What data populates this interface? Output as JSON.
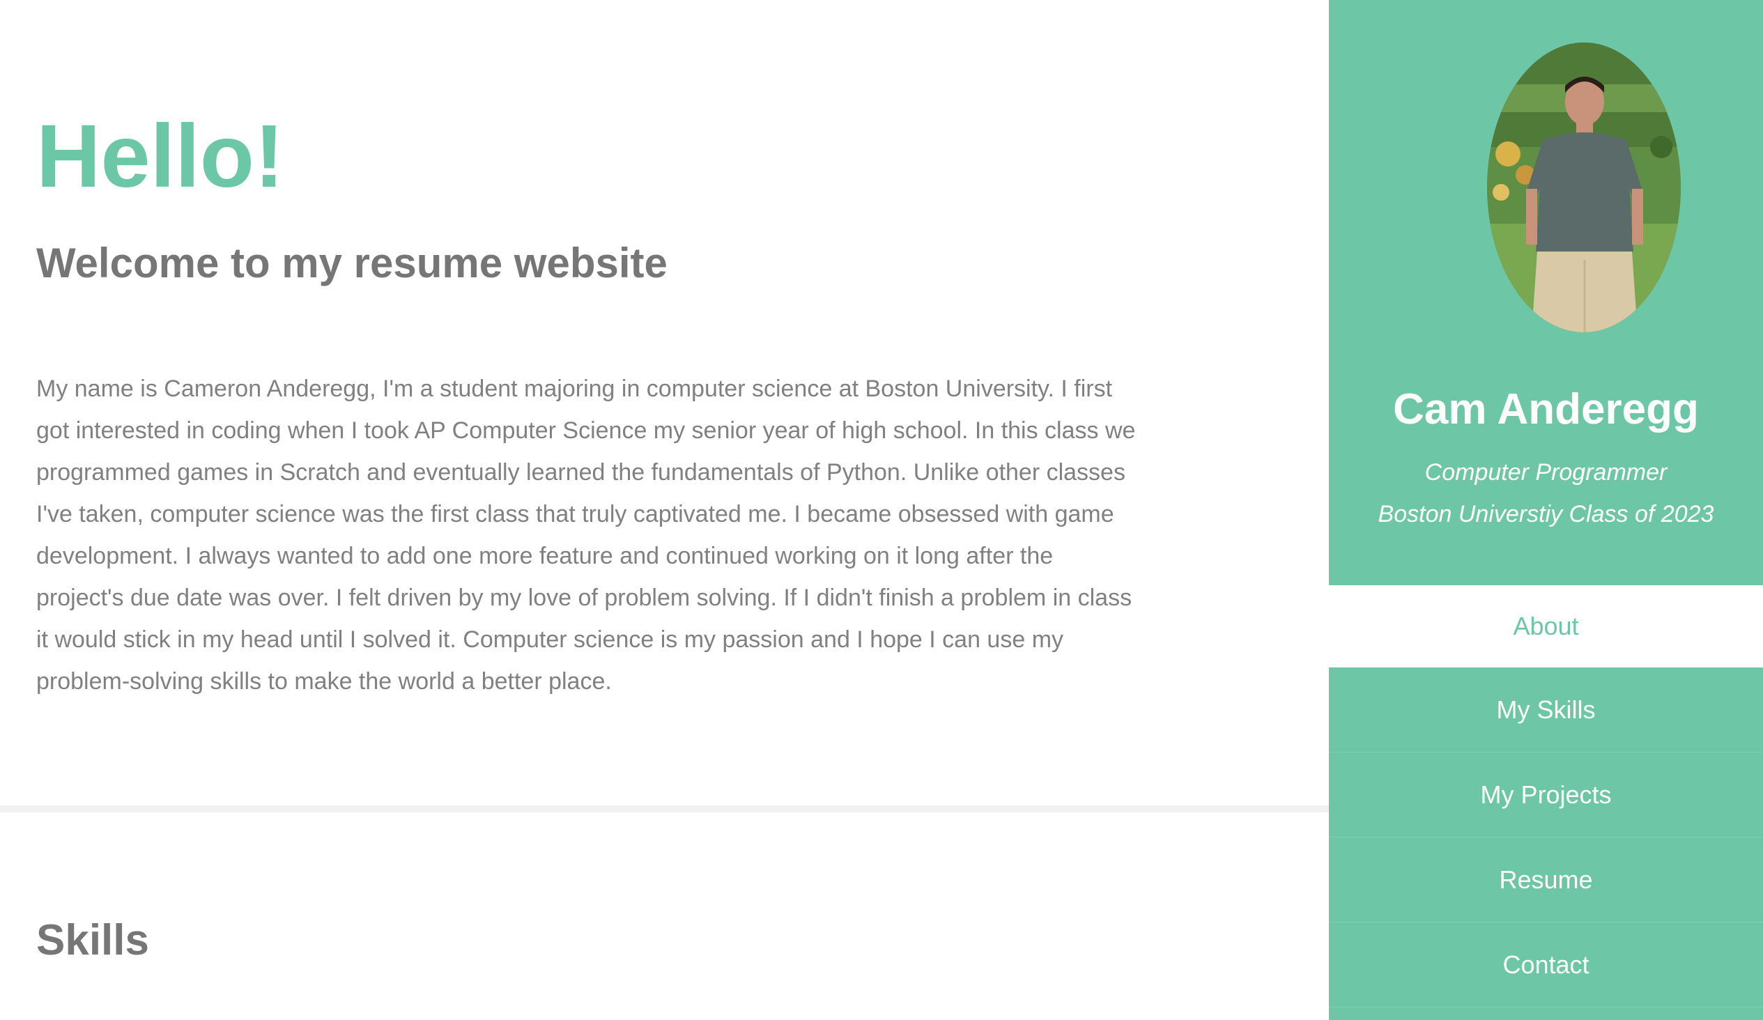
{
  "about": {
    "hello": "Hello!",
    "welcome": "Welcome to my resume website",
    "bio": "My name is Cameron Anderegg, I'm a student majoring in computer science at Boston University. I first got interested in coding when I took AP Computer Science my senior year of high school. In this class we programmed games in Scratch and eventually learned the fundamentals of Python. Unlike other classes I've taken, computer science was the first class that truly captivated me. I became obsessed with game development. I always wanted to add one more feature and continued working on it long after the project's due date was over. I felt driven by my love of problem solving. If I didn't finish a problem in class it would stick in my head until I solved it. Computer science is my passion and I hope I can use my problem-solving skills to make the world a better place."
  },
  "skills": {
    "heading": "Skills"
  },
  "sidebar": {
    "name": "Cam Anderegg",
    "role": "Computer Programmer",
    "school": "Boston Universtiy Class of 2023",
    "avatar_icon": "profile-photo",
    "nav": [
      {
        "label": "About",
        "active": true
      },
      {
        "label": "My Skills",
        "active": false
      },
      {
        "label": "My Projects",
        "active": false
      },
      {
        "label": "Resume",
        "active": false
      },
      {
        "label": "Contact",
        "active": false
      }
    ]
  },
  "colors": {
    "accent": "#6cc7a6",
    "sidebar": "#6dc7a6",
    "heading_gray": "#767676",
    "text_gray": "#808080"
  }
}
